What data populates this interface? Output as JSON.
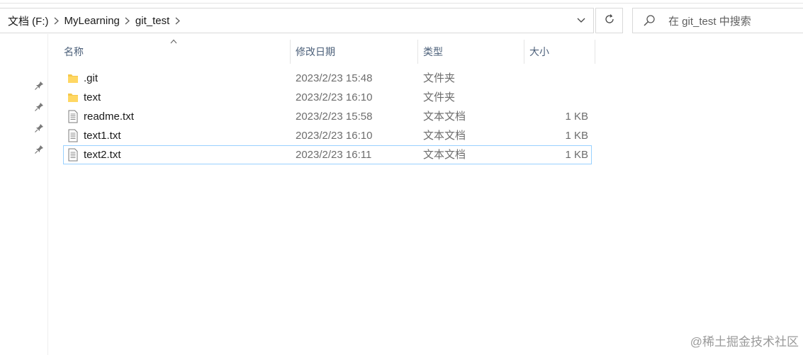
{
  "breadcrumb": [
    "文档 (F:)",
    "MyLearning",
    "git_test"
  ],
  "search": {
    "placeholder": "在 git_test 中搜索"
  },
  "columns": {
    "name": "名称",
    "date": "修改日期",
    "type": "类型",
    "size": "大小"
  },
  "files": [
    {
      "name": ".git",
      "date": "2023/2/23 15:48",
      "type": "文件夹",
      "size": "",
      "icon": "folder-icon"
    },
    {
      "name": "text",
      "date": "2023/2/23 16:10",
      "type": "文件夹",
      "size": "",
      "icon": "folder-icon"
    },
    {
      "name": "readme.txt",
      "date": "2023/2/23 15:58",
      "type": "文本文档",
      "size": "1 KB",
      "icon": "text-file-icon"
    },
    {
      "name": "text1.txt",
      "date": "2023/2/23 16:10",
      "type": "文本文档",
      "size": "1 KB",
      "icon": "text-file-icon"
    },
    {
      "name": "text2.txt",
      "date": "2023/2/23 16:11",
      "type": "文本文档",
      "size": "1 KB",
      "icon": "text-file-icon",
      "selected": true
    }
  ],
  "watermark": "@稀土掘金技术社区",
  "colors": {
    "selection_border": "#99d1ff",
    "header_text": "#4c607a",
    "folder": "#f5c84c"
  }
}
